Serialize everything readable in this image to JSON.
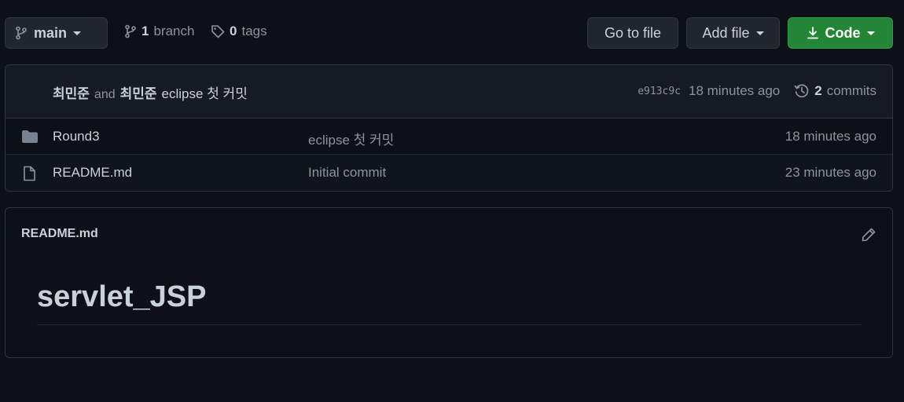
{
  "toolbar": {
    "branch_selector": {
      "label": "main",
      "icon": "git-branch-icon"
    },
    "branches": {
      "count": "1",
      "label": "branch",
      "icon": "git-branch-icon"
    },
    "tags": {
      "count": "0",
      "label": "tags",
      "icon": "tag-icon"
    },
    "go_to_file_label": "Go to file",
    "add_file_label": "Add file",
    "code_label": "Code",
    "code_icon": "download-icon"
  },
  "latest_commit": {
    "author1": "최민준",
    "and_text": "and",
    "author2": "최민준",
    "message": "eclipse 첫 커밋",
    "sha": "e913c9c",
    "time": "18 minutes ago",
    "commit_count": "2",
    "commit_count_label": "commits",
    "history_icon": "history-icon"
  },
  "files": [
    {
      "name": "Round3",
      "type": "folder",
      "icon": "folder-icon",
      "message": "eclipse 첫 커밋",
      "age": "18 minutes ago"
    },
    {
      "name": "README.md",
      "type": "file",
      "icon": "file-icon",
      "message": "Initial commit",
      "age": "23 minutes ago"
    }
  ],
  "readme": {
    "title": "README.md",
    "edit_icon": "pencil-icon",
    "heading": "servlet_JSP"
  },
  "colors": {
    "background": "#0d1117",
    "panel": "#161b22",
    "border": "#30363d",
    "text": "#c9d1d9",
    "muted": "#8b949e",
    "code_button": "#238636",
    "folder_icon": "#768390"
  }
}
